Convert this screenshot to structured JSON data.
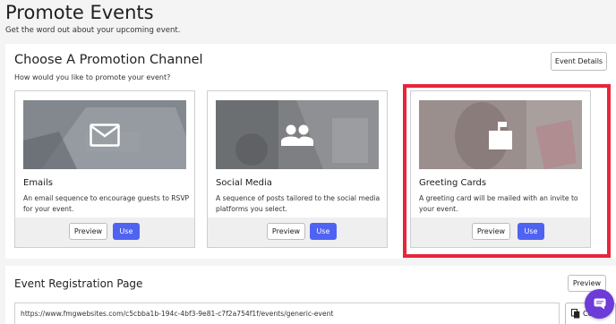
{
  "header": {
    "title": "Promote Events",
    "subtitle": "Get the word out about your upcoming event."
  },
  "channel_section": {
    "title": "Choose A Promotion Channel",
    "subtitle": "How would you like to promote your event?",
    "details_button": "Event Details",
    "cards": [
      {
        "title": "Emails",
        "description": "An email sequence to encourage guests to RSVP for your event.",
        "icon": "envelope-icon",
        "preview_label": "Preview",
        "use_label": "Use"
      },
      {
        "title": "Social Media",
        "description": "A sequence of posts tailored to the social media platforms you select.",
        "icon": "people-icon",
        "preview_label": "Preview",
        "use_label": "Use"
      },
      {
        "title": "Greeting Cards",
        "description": "A greeting card will be mailed with an invite to your event.",
        "icon": "mailbox-icon",
        "preview_label": "Preview",
        "use_label": "Use"
      }
    ]
  },
  "registration_section": {
    "title": "Event Registration Page",
    "preview_label": "Preview",
    "url": "https://www.fmgwebsites.com/c5cbba1b-194c-4bf3-9e81-c7f2a754f1f/events/generic-event",
    "copy_label": "Copy",
    "copy_icon": "copy-icon"
  },
  "chat": {
    "icon": "chat-icon"
  },
  "colors": {
    "accent": "#4f63f2",
    "highlight": "#e8253a",
    "chat": "#6d3bd8"
  }
}
